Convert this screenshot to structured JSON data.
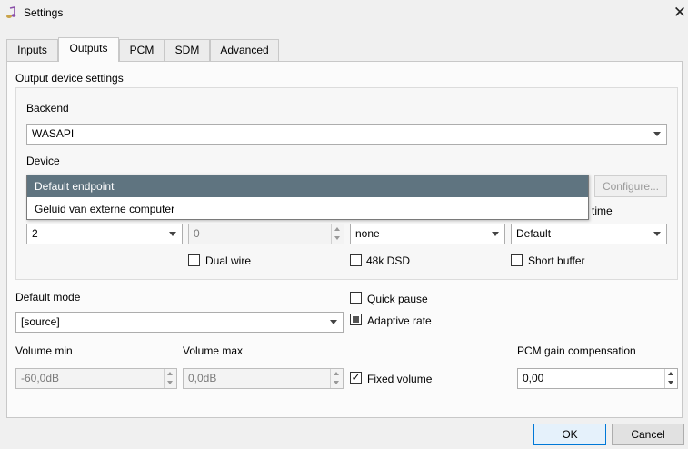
{
  "window": {
    "title": "Settings",
    "app_icon": "music-note-icon",
    "close_icon": "close-icon",
    "close_glyph": "✕"
  },
  "tabs": [
    {
      "label": "Inputs",
      "active": false
    },
    {
      "label": "Outputs",
      "active": true
    },
    {
      "label": "PCM",
      "active": false
    },
    {
      "label": "SDM",
      "active": false
    },
    {
      "label": "Advanced",
      "active": false
    }
  ],
  "output_group": {
    "title": "Output device settings",
    "backend_label": "Backend",
    "backend_value": "WASAPI",
    "device_label": "Device",
    "configure_label": "Configure...",
    "device_options": [
      "Default endpoint",
      "Geluid van externe computer"
    ],
    "time_label_partial": "time",
    "channels_value": "2",
    "offset_value": "0",
    "none_value": "none",
    "buffer_value": "Default",
    "dual_wire_label": "Dual wire",
    "dsd48k_label": "48k DSD",
    "short_buffer_label": "Short buffer"
  },
  "default_mode": {
    "label": "Default mode",
    "value": "[source]"
  },
  "quick_pause_label": "Quick pause",
  "adaptive_rate_label": "Adaptive rate",
  "volume_min": {
    "label": "Volume min",
    "value": "-60,0dB"
  },
  "volume_max": {
    "label": "Volume max",
    "value": "0,0dB"
  },
  "fixed_volume": {
    "label": "Fixed volume",
    "mark": "✓"
  },
  "pcm_gain": {
    "label": "PCM gain compensation",
    "value": "0,00"
  },
  "footer": {
    "ok_label": "OK",
    "cancel_label": "Cancel"
  },
  "colors": {
    "selection": "#5f7480",
    "accent": "#0078d7"
  }
}
